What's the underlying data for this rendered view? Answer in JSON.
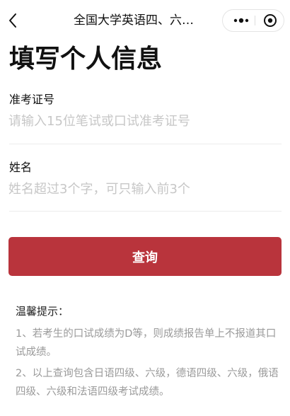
{
  "nav": {
    "title": "全国大学英语四、六…",
    "back_icon": "chevron-left-icon",
    "more_icon": "more-dots-icon",
    "close_icon": "miniprogram-close-icon"
  },
  "page": {
    "title": "填写个人信息"
  },
  "form": {
    "exam_id": {
      "label": "准考证号",
      "placeholder": "请输入15位笔试或口试准考证号",
      "value": ""
    },
    "name": {
      "label": "姓名",
      "placeholder": "姓名超过3个字，可只输入前3个",
      "value": ""
    },
    "submit_label": "查询"
  },
  "tips": {
    "title": "温馨提示：",
    "items": [
      "1、若考生的口试成绩为D等，则成绩报告单上不报道其口试成绩。",
      "2、以上查询包含日语四级、六级，德语四级、六级，俄语四级、六级和法语四级考试成绩。"
    ]
  },
  "colors": {
    "primary_button": "#b9343c",
    "placeholder": "#c7c7c7",
    "tip_text": "#9a9a9a"
  }
}
